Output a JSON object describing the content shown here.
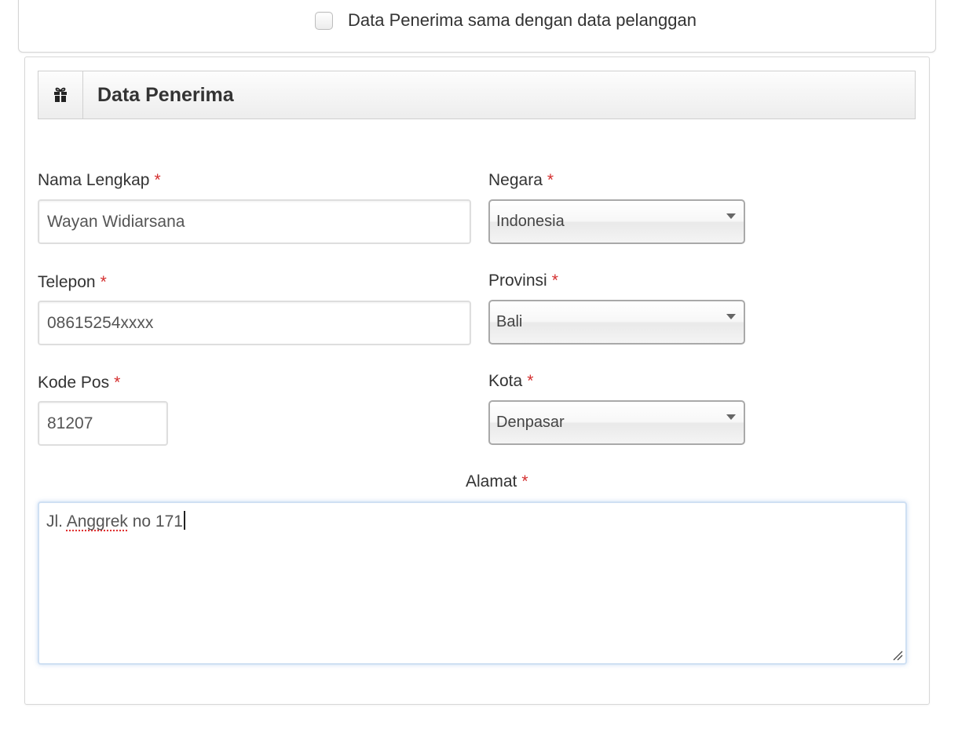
{
  "same_as_customer": {
    "label": "Data Penerima sama dengan data pelanggan",
    "checked": false
  },
  "section": {
    "title": "Data Penerima",
    "icon": "gift-icon"
  },
  "required_marker": "*",
  "fields": {
    "nama_lengkap": {
      "label": "Nama Lengkap",
      "value": "Wayan Widiarsana"
    },
    "telepon": {
      "label": "Telepon",
      "value": "08615254xxxx"
    },
    "kode_pos": {
      "label": "Kode Pos",
      "value": "81207"
    },
    "negara": {
      "label": "Negara",
      "value": "Indonesia"
    },
    "provinsi": {
      "label": "Provinsi",
      "value": "Bali"
    },
    "kota": {
      "label": "Kota",
      "value": "Denpasar"
    },
    "alamat": {
      "label": "Alamat",
      "value_part1": "Jl. ",
      "value_misspelled": "Anggrek",
      "value_part2": " no 171"
    }
  },
  "colors": {
    "required": "#d42e2e",
    "focus_border": "#cfe0f3",
    "spellcheck": "#e03131"
  }
}
